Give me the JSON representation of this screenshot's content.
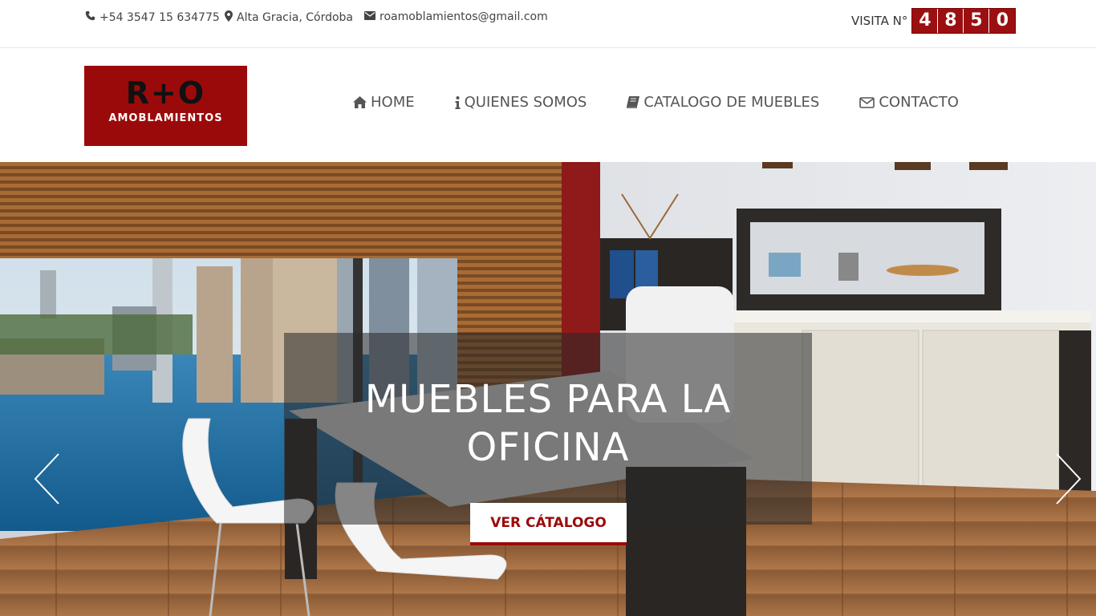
{
  "topbar": {
    "phone": "+54 3547 15 634775",
    "location": "Alta Gracia, Córdoba",
    "email": "roamoblamientos@gmail.com",
    "visit_label": "VISITA N°",
    "visit_digits": [
      "4",
      "8",
      "5",
      "0"
    ]
  },
  "logo": {
    "main": "R+O",
    "sub": "AMOBLAMIENTOS"
  },
  "nav": {
    "items": [
      {
        "label": "HOME",
        "icon": "home-icon"
      },
      {
        "label": "QUIENES SOMOS",
        "icon": "info-icon"
      },
      {
        "label": "CATALOGO DE MUEBLES",
        "icon": "book-icon"
      },
      {
        "label": "CONTACTO",
        "icon": "envelope-icon"
      }
    ]
  },
  "hero": {
    "title": "MUEBLES PARA LA OFICINA",
    "cta_label": "VER CÁTALOGO"
  },
  "colors": {
    "brand": "#9b0a0a",
    "text": "#555555"
  }
}
